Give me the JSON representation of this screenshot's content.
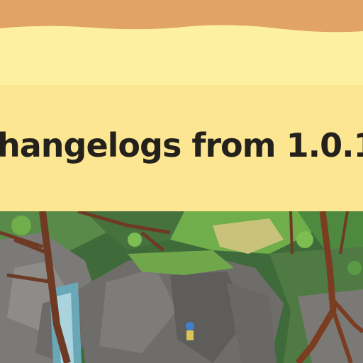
{
  "header": {
    "title": "hangelogs from 1.0.1"
  },
  "colors": {
    "top_band": "#e1a466",
    "pale_banner": "#fdf0a0",
    "title_panel": "#fde691",
    "title_text": "#24211c"
  },
  "scene": {
    "image_description_icon": "game-artwork-image"
  }
}
